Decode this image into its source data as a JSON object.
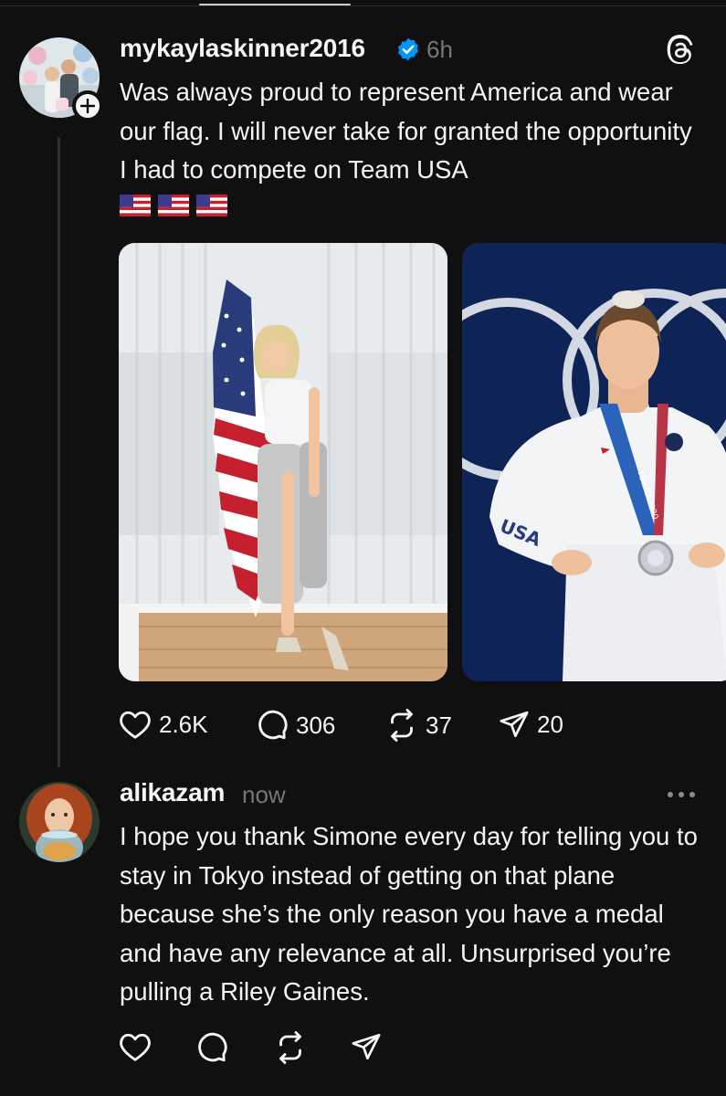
{
  "post": {
    "username": "mykaylaskinner2016",
    "verified": true,
    "time": "6h",
    "text": "Was always proud to represent America and wear our flag. I will never take for granted the opportunity I had to compete on Team USA",
    "emoji": "🇺🇸🇺🇸🇺🇸",
    "images": [
      {
        "description": "woman-holding-american-flag"
      },
      {
        "description": "gymnast-in-white-team-usa-jacket-with-silver-medal",
        "jacket_text": "USA",
        "lanyard_text": "TOKYO 2020"
      }
    ],
    "stats": {
      "likes": "2.6K",
      "replies": "306",
      "reposts": "37",
      "shares": "20"
    }
  },
  "reply": {
    "username": "alikazam",
    "time": "now",
    "text": "I hope you thank Simone every day for telling you to stay in Tokyo instead of getting on that plane because she’s the only reason you have a medal and have any relevance at all. Unsurprised you’re pulling a Riley Gaines."
  },
  "icons": {
    "app": "threads-icon",
    "verified": "verified-badge-icon",
    "follow": "plus-icon",
    "like": "heart-icon",
    "reply": "comment-icon",
    "repost": "repost-icon",
    "share": "send-icon",
    "more": "more-icon"
  },
  "colors": {
    "background": "#101010",
    "text": "#f3f5f7",
    "muted": "#777777",
    "verified": "#0095f6"
  }
}
